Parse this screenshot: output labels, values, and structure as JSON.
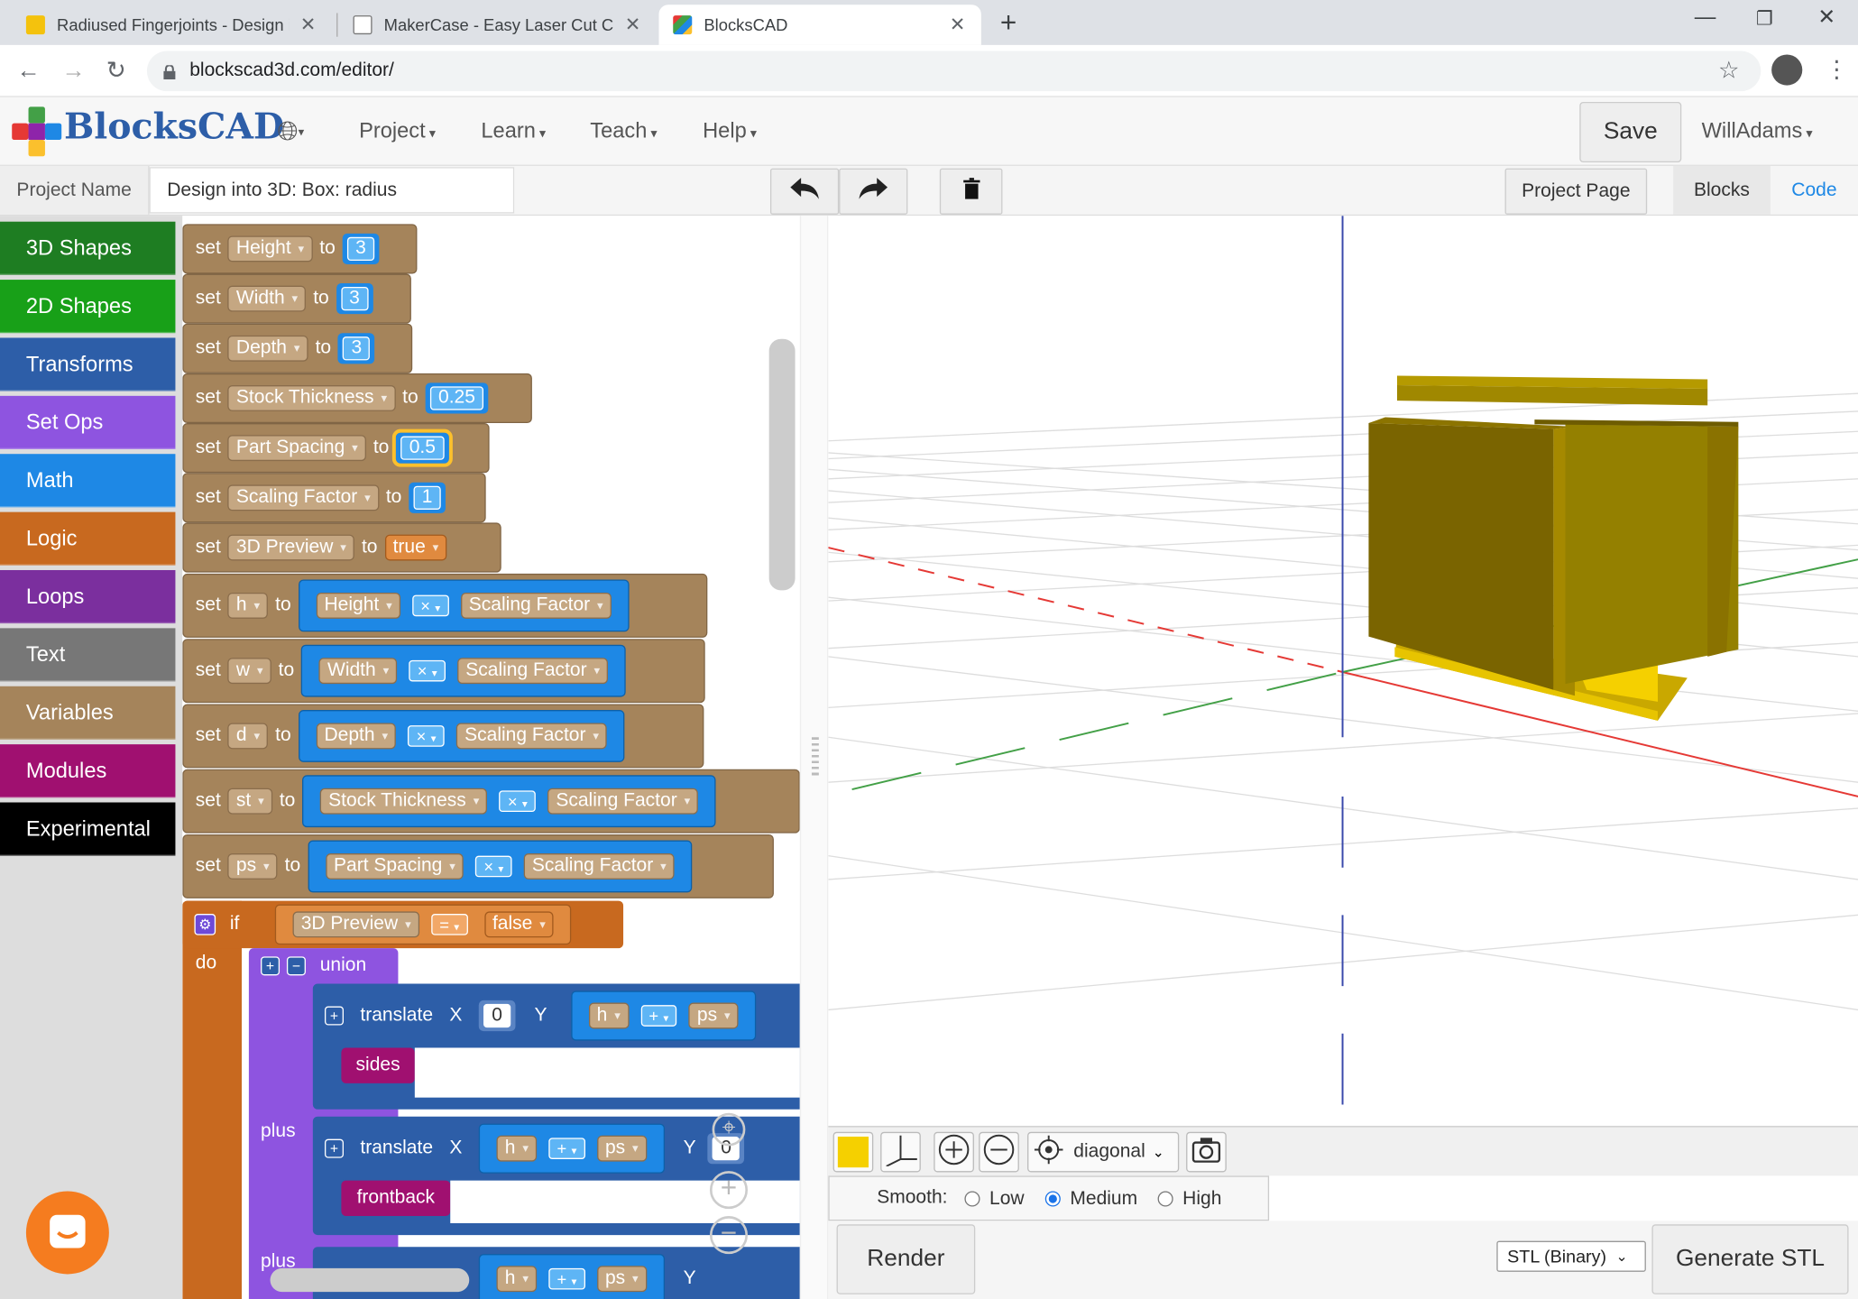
{
  "browser": {
    "tabs": [
      {
        "title": "Radiused Fingerjoints - Design in",
        "favicon_color": "#f4c20d"
      },
      {
        "title": "MakerCase - Easy Laser Cut Case",
        "favicon_color": "#888888"
      },
      {
        "title": "BlocksCAD",
        "favicon_color": "#e53935"
      }
    ],
    "url": "blockscad3d.com/editor/"
  },
  "app": {
    "brand": "BlocksCAD",
    "menus": [
      "Project",
      "Learn",
      "Teach",
      "Help"
    ],
    "save_label": "Save",
    "user": "WillAdams"
  },
  "project": {
    "name_label": "Project Name",
    "name_value": "Design into 3D: Box: radius",
    "project_page": "Project Page",
    "blocks_tab": "Blocks",
    "code_tab": "Code"
  },
  "toolbox": [
    {
      "label": "3D Shapes",
      "color": "#1e7d22"
    },
    {
      "label": "2D Shapes",
      "color": "#18a018"
    },
    {
      "label": "Transforms",
      "color": "#2d5ea8"
    },
    {
      "label": "Set Ops",
      "color": "#8e54e0"
    },
    {
      "label": "Math",
      "color": "#1e88e5"
    },
    {
      "label": "Logic",
      "color": "#c8691f"
    },
    {
      "label": "Loops",
      "color": "#7b2f9e"
    },
    {
      "label": "Text",
      "color": "#777777"
    },
    {
      "label": "Variables",
      "color": "#a5845b"
    },
    {
      "label": "Modules",
      "color": "#a01070"
    },
    {
      "label": "Experimental",
      "color": "#000000"
    }
  ],
  "blocks": {
    "set_word": "set",
    "to_word": "to",
    "simple": [
      {
        "var": "Height",
        "value": "3"
      },
      {
        "var": "Width",
        "value": "3"
      },
      {
        "var": "Depth",
        "value": "3"
      },
      {
        "var": "Stock Thickness",
        "value": "0.25"
      },
      {
        "var": "Part Spacing",
        "value": "0.5"
      },
      {
        "var": "Scaling Factor",
        "value": "1"
      },
      {
        "var": "3D Preview",
        "value": "true"
      }
    ],
    "products": [
      {
        "var": "h",
        "a": "Height",
        "op": "×",
        "b": "Scaling Factor"
      },
      {
        "var": "w",
        "a": "Width",
        "op": "×",
        "b": "Scaling Factor"
      },
      {
        "var": "d",
        "a": "Depth",
        "op": "×",
        "b": "Scaling Factor"
      },
      {
        "var": "st",
        "a": "Stock Thickness",
        "op": "×",
        "b": "Scaling Factor"
      },
      {
        "var": "ps",
        "a": "Part Spacing",
        "op": "×",
        "b": "Scaling Factor"
      }
    ],
    "if_word": "if",
    "do_word": "do",
    "if_var": "3D Preview",
    "if_op": "=",
    "if_val": "false",
    "union": "union",
    "translate": "translate",
    "x_label": "X",
    "y_label": "Y",
    "plus": "plus",
    "zero": "0",
    "h": "h",
    "ps": "ps",
    "plus_op": "+",
    "sides": "sides",
    "frontback": "frontback"
  },
  "viewer": {
    "view_select": "diagonal",
    "smooth_label": "Smooth:",
    "smooth_options": [
      "Low",
      "Medium",
      "High"
    ],
    "smooth_selected": "Medium",
    "render": "Render",
    "export_format": "STL (Binary)",
    "generate": "Generate STL"
  }
}
